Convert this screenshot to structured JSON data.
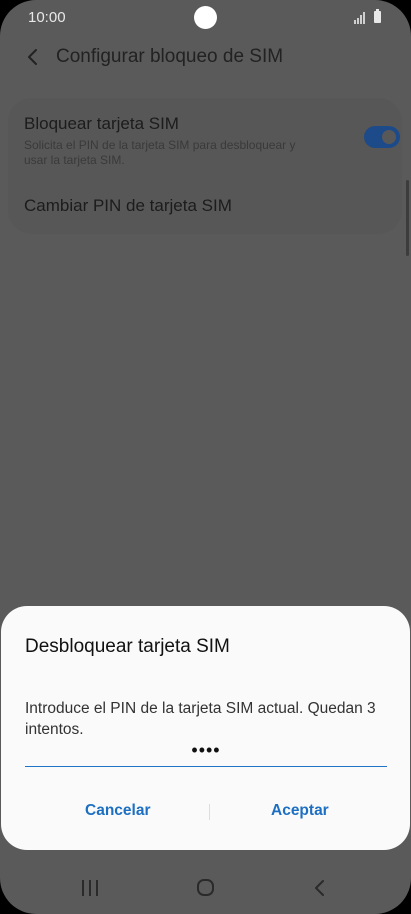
{
  "status_bar": {
    "time": "10:00"
  },
  "app_bar": {
    "title": "Configurar bloqueo de SIM",
    "back_icon": "chevron-left-icon"
  },
  "settings": {
    "lock_sim": {
      "title": "Bloquear tarjeta SIM",
      "subtitle": "Solicita el PIN de la tarjeta SIM para desbloquear y usar la tarjeta SIM.",
      "enabled": true
    },
    "change_pin": {
      "title": "Cambiar PIN de tarjeta SIM"
    }
  },
  "dialog": {
    "title": "Desbloquear tarjeta SIM",
    "message": "Introduce el PIN de la tarjeta SIM actual. Quedan 3 intentos.",
    "pin_value": "••••",
    "cancel_label": "Cancelar",
    "accept_label": "Aceptar"
  },
  "colors": {
    "accent": "#1d6fc2",
    "dialog_bg": "#fafafa",
    "dim_bg": "#5a5a5a"
  },
  "nav_bar": {
    "icons": [
      "recent-apps-icon",
      "home-icon",
      "back-icon"
    ]
  }
}
